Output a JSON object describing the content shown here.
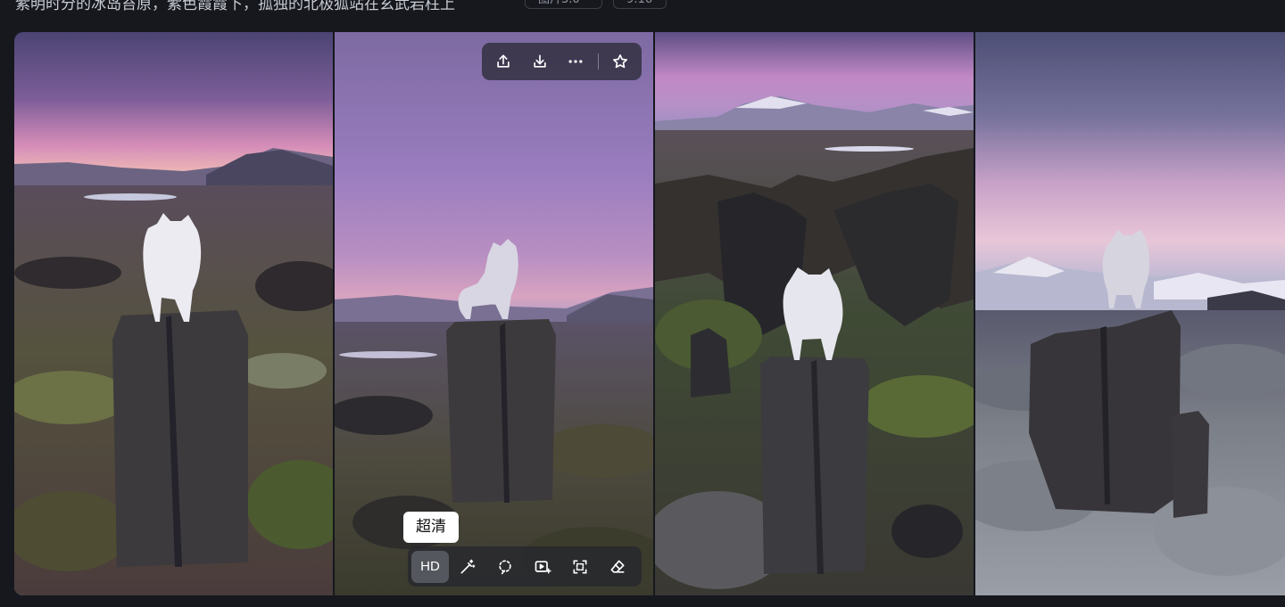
{
  "header": {
    "prompt_text": "紫明时分的冰岛苔原，紫色霞霞下，孤独的北极狐站在玄武岩柱上",
    "chips": [
      "图片3.0",
      "9:16"
    ]
  },
  "gallery": {
    "images": [
      {
        "scene": "arctic fox on basalt pillar, pink sunset, tundra"
      },
      {
        "scene": "arctic fox on basalt pillar, purple twilight sky"
      },
      {
        "scene": "arctic fox on basalt pillar, canyon cliffs"
      },
      {
        "scene": "arctic fox on basalt pillar, frosted tundra, snowy mountains"
      }
    ]
  },
  "image_actions": {
    "top": [
      {
        "icon": "share-icon"
      },
      {
        "icon": "download-icon"
      },
      {
        "icon": "more-icon"
      },
      {
        "icon": "star-icon"
      }
    ],
    "bottom": [
      {
        "icon": "hd-icon",
        "label": "HD"
      },
      {
        "icon": "magic-wand-icon"
      },
      {
        "icon": "lasso-erase-icon"
      },
      {
        "icon": "expand-image-icon"
      },
      {
        "icon": "crop-icon"
      },
      {
        "icon": "eraser-icon"
      }
    ]
  },
  "tooltip": {
    "text": "超清"
  },
  "colors": {
    "background": "#16181e",
    "toolbar_bg": "#24262e",
    "tooltip_bg": "#ffffff"
  }
}
